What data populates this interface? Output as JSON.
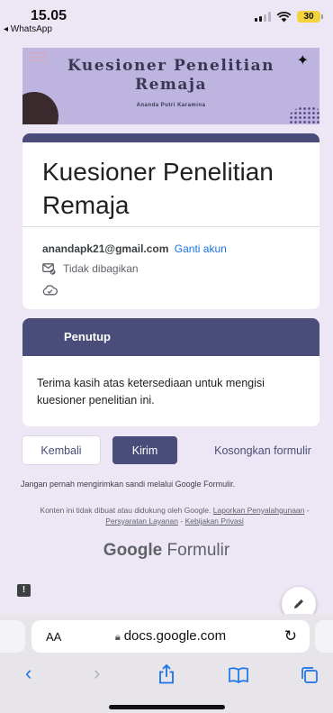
{
  "status_bar": {
    "time": "15.05",
    "back_app": "◂ WhatsApp",
    "battery": "30"
  },
  "banner": {
    "title_line1": "Kuesioner Penelitian",
    "title_line2": "Remaja",
    "subtitle": "Ananda Putri Karamina"
  },
  "form": {
    "title": "Kuesioner Penelitian Remaja",
    "account_email": "anandapk21@gmail.com",
    "switch_account": "Ganti akun",
    "not_shared": "Tidak dibagikan"
  },
  "section": {
    "title": "Penutup",
    "text": "Terima kasih atas ketersediaan untuk mengisi kuesioner penelitian ini."
  },
  "buttons": {
    "back": "Kembali",
    "submit": "Kirim",
    "clear": "Kosongkan formulir"
  },
  "footer": {
    "password_note": "Jangan pernah mengirimkan sandi melalui Google Formulir.",
    "disclaimer": "Konten ini tidak dibuat atau didukung oleh Google.",
    "report_abuse": "Laporkan Penyalahgunaan",
    "separator": " - ",
    "terms": "Persyaratan Layanan",
    "privacy": "Kebijakan Privasi",
    "brand_google": "Google",
    "brand_product": "Formulir"
  },
  "browser": {
    "text_size": "AA",
    "url": "docs.google.com"
  },
  "colors": {
    "accent": "#4a4d79",
    "background": "#ede7f5",
    "banner": "#bdb5df",
    "link": "#1a73e8"
  },
  "icons": [
    "cellular-signal-icon",
    "wifi-icon",
    "battery-icon",
    "mail-not-shared-icon",
    "cloud-saved-icon",
    "feedback-icon",
    "edit-pencil-icon",
    "lock-icon",
    "reload-icon",
    "back-arrow-icon",
    "forward-arrow-icon",
    "share-icon",
    "bookmarks-icon",
    "tabs-icon"
  ]
}
